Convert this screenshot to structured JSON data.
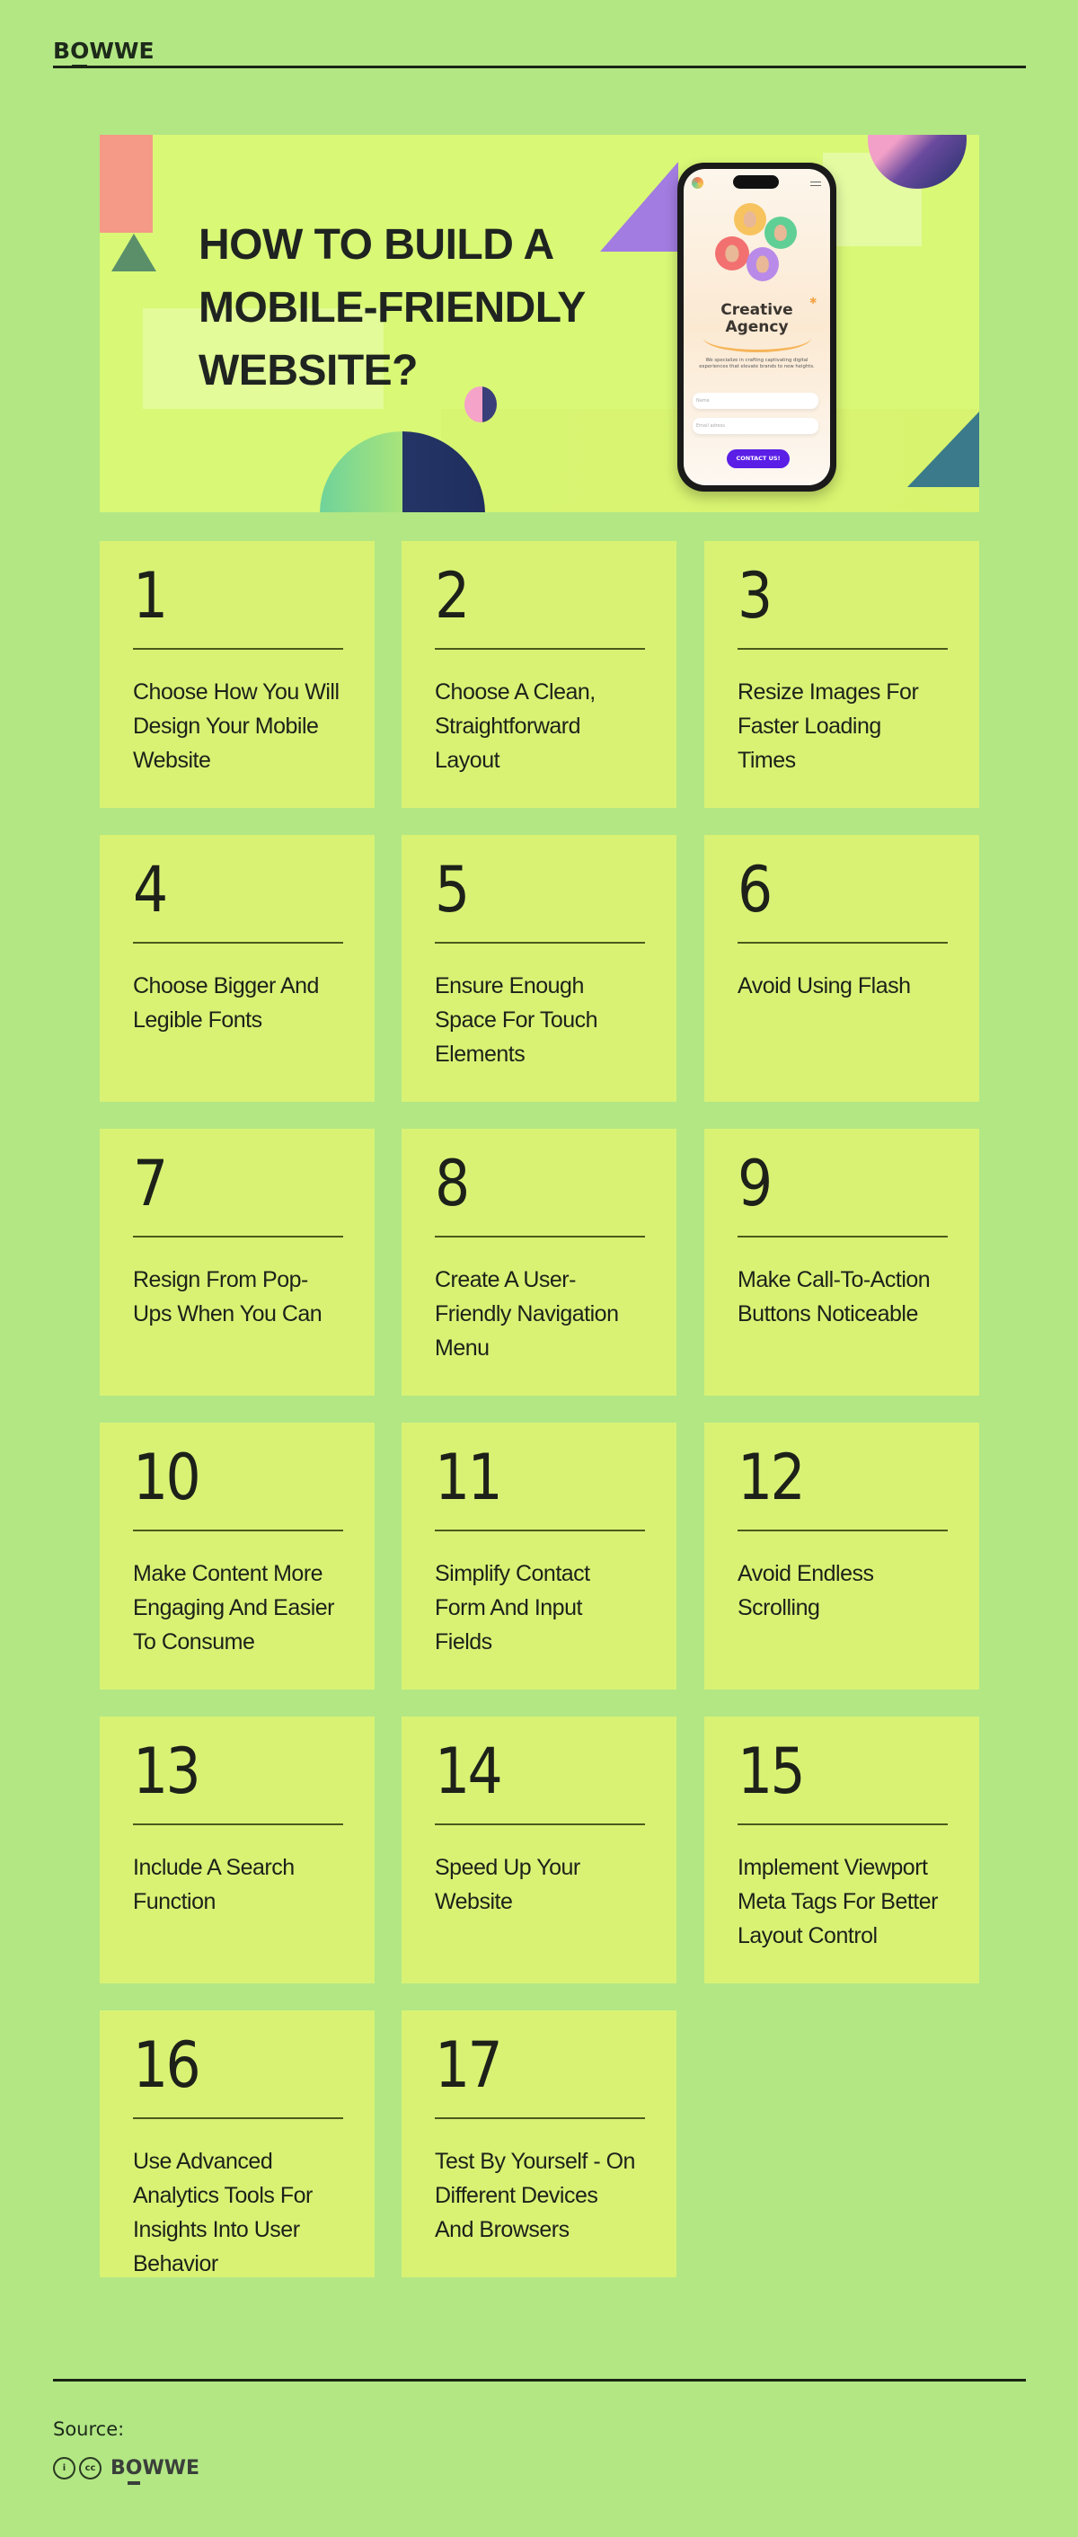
{
  "header": {
    "brand": {
      "pre": "B",
      "o": "O",
      "post": "WWE"
    }
  },
  "hero": {
    "title_lines": [
      "HOW TO BUILD A",
      "MOBILE-FRIENDLY",
      "WEBSITE?"
    ],
    "phone": {
      "title_lines": [
        "Creative",
        "Agency"
      ],
      "subtitle": "We specialize in crafting captivating digital experiences that elevate brands to new heights.",
      "name_placeholder": "Name",
      "email_placeholder": "Email adress",
      "cta_label": "CONTACT US!"
    }
  },
  "steps": [
    {
      "number": "1",
      "lines": [
        "Choose How You Will",
        "Design Your Mobile",
        "Website"
      ]
    },
    {
      "number": "2",
      "lines": [
        "Choose A Clean,",
        "Straightforward",
        "Layout"
      ]
    },
    {
      "number": "3",
      "lines": [
        "Resize Images For",
        "Faster Loading",
        "Times"
      ]
    },
    {
      "number": "4",
      "lines": [
        "Choose Bigger And",
        "Legible Fonts"
      ]
    },
    {
      "number": "5",
      "lines": [
        "Ensure Enough",
        "Space For Touch",
        "Elements"
      ]
    },
    {
      "number": "6",
      "lines": [
        "Avoid Using Flash"
      ]
    },
    {
      "number": "7",
      "lines": [
        "Resign From Pop-",
        "Ups When You Can"
      ]
    },
    {
      "number": "8",
      "lines": [
        "Create A User-",
        "Friendly Navigation",
        "Menu"
      ]
    },
    {
      "number": "9",
      "lines": [
        "Make Call-To-Action",
        "Buttons Noticeable"
      ]
    },
    {
      "number": "10",
      "lines": [
        "Make Content More",
        "Engaging And Easier",
        "To Consume"
      ]
    },
    {
      "number": "11",
      "lines": [
        "Simplify Contact",
        "Form And Input",
        "Fields"
      ]
    },
    {
      "number": "12",
      "lines": [
        "Avoid Endless",
        "Scrolling"
      ]
    },
    {
      "number": "13",
      "lines": [
        "Include A Search",
        "Function"
      ]
    },
    {
      "number": "14",
      "lines": [
        "Speed Up Your",
        "Website"
      ]
    },
    {
      "number": "15",
      "lines": [
        "Implement Viewport",
        "Meta Tags For Better",
        "Layout Control"
      ]
    },
    {
      "number": "16",
      "lines": [
        "Use Advanced",
        "Analytics Tools For",
        "Insights Into User",
        "Behavior"
      ]
    },
    {
      "number": "17",
      "lines": [
        "Test By Yourself - On",
        "Different Devices",
        "And Browsers"
      ]
    }
  ],
  "footer": {
    "source_label": "Source:",
    "license_icons": [
      "attribution-icon",
      "cc-icon"
    ],
    "attribution_glyph": "i",
    "cc_glyph": "cc",
    "brand": {
      "pre": "B",
      "o": "O",
      "post": "WWE"
    }
  },
  "colors": {
    "page_bg": "#b2e784",
    "card_bg": "#d9f274",
    "hero_bg": "#d9f876",
    "text": "#1d2119",
    "cta": "#5a1ee6"
  }
}
